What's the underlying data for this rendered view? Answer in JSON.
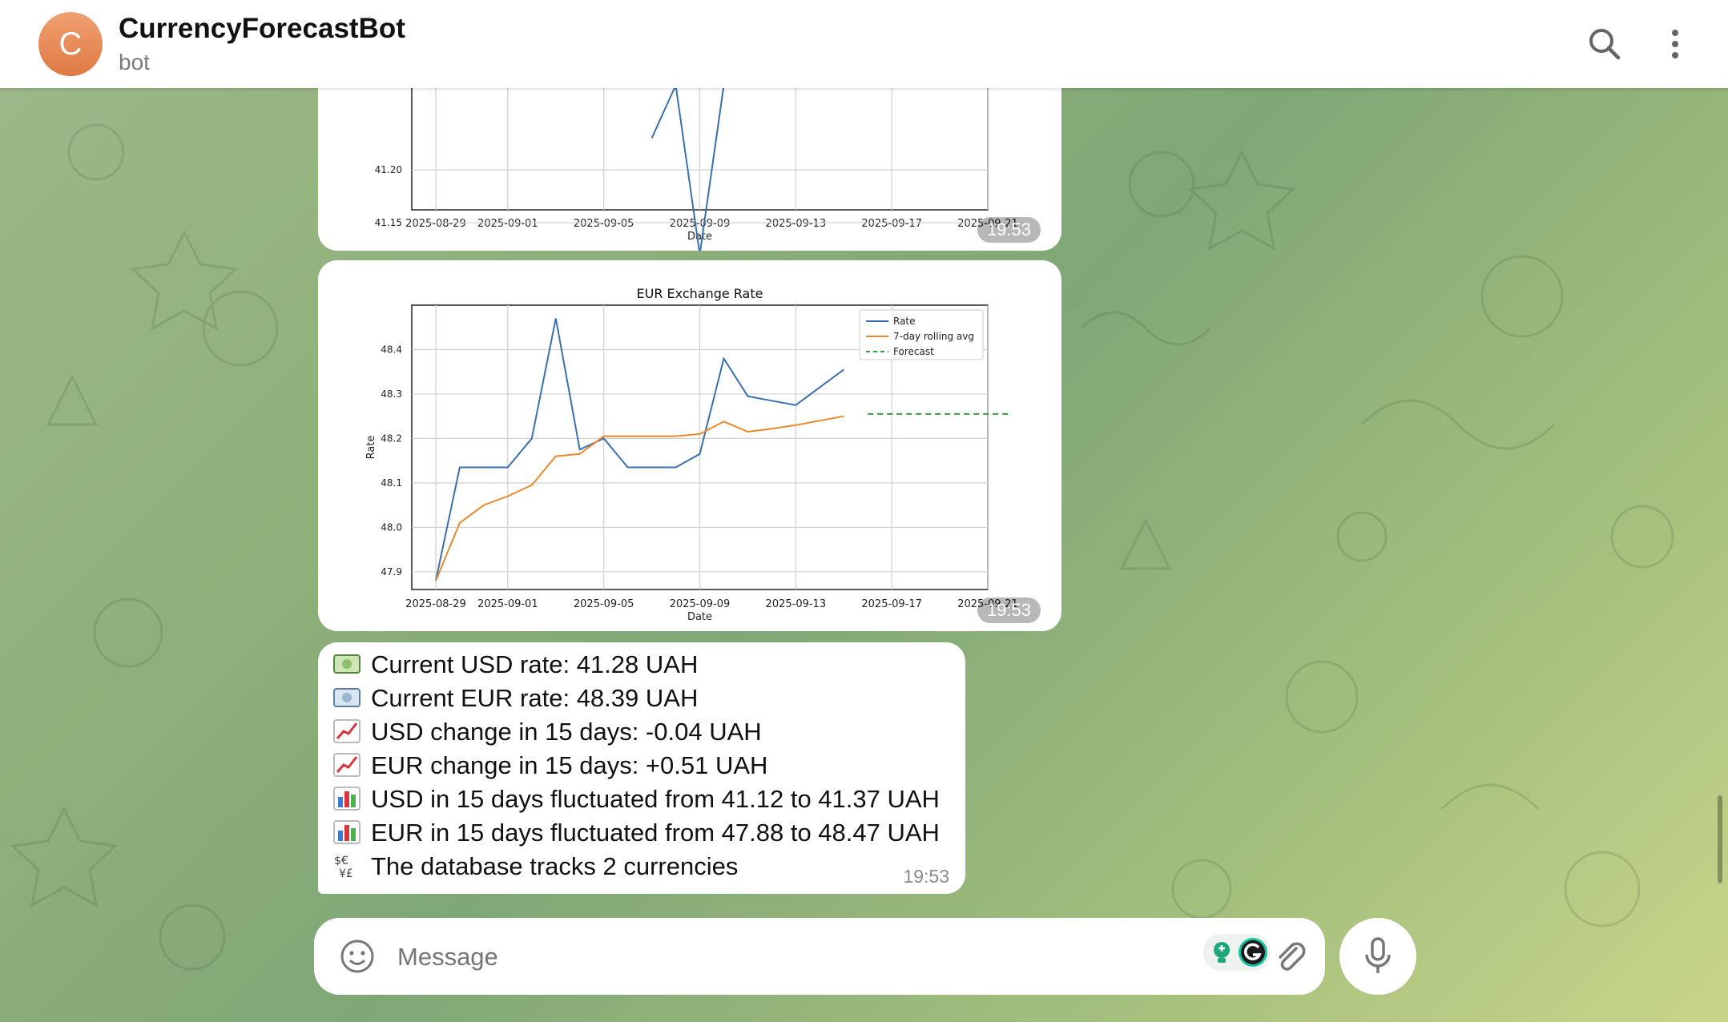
{
  "header": {
    "avatar_letter": "C",
    "title": "CurrencyForecastBot",
    "subtitle": "bot",
    "icons": [
      "search-icon",
      "more-vertical-icon"
    ]
  },
  "colors": {
    "rate_line": "#3a6fb0",
    "rolling_avg_line": "#e8892b",
    "forecast_line": "#2e9e3c",
    "avatar": "#e8834f"
  },
  "messages": [
    {
      "type": "chart",
      "time": "19:53",
      "chart_data": {
        "type": "line",
        "title": "",
        "xlabel": "Date",
        "ylabel": "",
        "x_ticks": [
          "2025-08-29",
          "2025-09-01",
          "2025-09-05",
          "2025-09-09",
          "2025-09-13",
          "2025-09-17",
          "2025-09-21"
        ],
        "y_ticks": [
          "41.20",
          "41.15"
        ],
        "cropped": true,
        "series": [
          {
            "name": "Rate",
            "x": [
              "2025-09-07",
              "2025-09-08",
              "2025-09-09",
              "2025-09-10"
            ],
            "y": [
              41.23,
              41.28,
              41.12,
              41.28
            ]
          }
        ]
      }
    },
    {
      "type": "chart",
      "time": "19:53",
      "chart_data": {
        "type": "line",
        "title": "EUR Exchange Rate",
        "xlabel": "Date",
        "ylabel": "Rate",
        "x_ticks": [
          "2025-08-29",
          "2025-09-01",
          "2025-09-05",
          "2025-09-09",
          "2025-09-13",
          "2025-09-17",
          "2025-09-21"
        ],
        "y_ticks": [
          "48.4",
          "48.3",
          "48.2",
          "48.1",
          "48.0",
          "47.9"
        ],
        "xlim": [
          "2025-08-28",
          "2025-09-21"
        ],
        "ylim": [
          47.86,
          48.5
        ],
        "grid": true,
        "legend": "top-right",
        "series": [
          {
            "name": "Rate",
            "x": [
              "2025-08-29",
              "2025-08-30",
              "2025-08-31",
              "2025-09-01",
              "2025-09-02",
              "2025-09-03",
              "2025-09-04",
              "2025-09-05",
              "2025-09-06",
              "2025-09-07",
              "2025-09-08",
              "2025-09-09",
              "2025-09-10",
              "2025-09-11",
              "2025-09-12",
              "2025-09-13",
              "2025-09-14",
              "2025-09-15"
            ],
            "y": [
              47.88,
              48.135,
              48.135,
              48.135,
              48.2,
              48.47,
              48.175,
              48.2,
              48.135,
              48.135,
              48.135,
              48.165,
              48.38,
              48.295,
              48.285,
              48.275,
              48.315,
              48.355
            ]
          },
          {
            "name": "7-day rolling avg",
            "x": [
              "2025-08-29",
              "2025-08-30",
              "2025-08-31",
              "2025-09-01",
              "2025-09-02",
              "2025-09-03",
              "2025-09-04",
              "2025-09-05",
              "2025-09-06",
              "2025-09-07",
              "2025-09-08",
              "2025-09-09",
              "2025-09-10",
              "2025-09-11",
              "2025-09-12",
              "2025-09-13",
              "2025-09-14",
              "2025-09-15"
            ],
            "y": [
              47.88,
              48.01,
              48.05,
              48.07,
              48.095,
              48.16,
              48.165,
              48.205,
              48.205,
              48.205,
              48.205,
              48.21,
              48.238,
              48.215,
              48.222,
              48.23,
              48.24,
              48.25
            ]
          },
          {
            "name": "Forecast",
            "x": [
              "2025-09-16",
              "2025-09-22"
            ],
            "y": [
              48.255,
              48.255
            ]
          }
        ]
      }
    },
    {
      "type": "text",
      "time": "19:53",
      "lines": [
        {
          "icon": "money-usd-icon",
          "text": "Current USD rate: 41.28 UAH"
        },
        {
          "icon": "money-eur-icon",
          "text": "Current EUR rate: 48.39 UAH"
        },
        {
          "icon": "chart-increasing-icon",
          "text": "USD change in 15 days: -0.04 UAH"
        },
        {
          "icon": "chart-increasing-icon",
          "text": "EUR change in 15 days: +0.51 UAH"
        },
        {
          "icon": "bar-chart-icon",
          "text": "USD in 15 days fluctuated from 41.12 to 41.37 UAH"
        },
        {
          "icon": "bar-chart-icon",
          "text": "EUR in 15 days fluctuated from 47.88 to 48.47 UAH"
        },
        {
          "icon": "currency-exchange-icon",
          "text": "The database tracks  2 currencies"
        }
      ]
    }
  ],
  "composer": {
    "placeholder": "Message",
    "icons": [
      "emoji-icon",
      "grammarly-icon",
      "attach-icon",
      "microphone-icon"
    ]
  }
}
